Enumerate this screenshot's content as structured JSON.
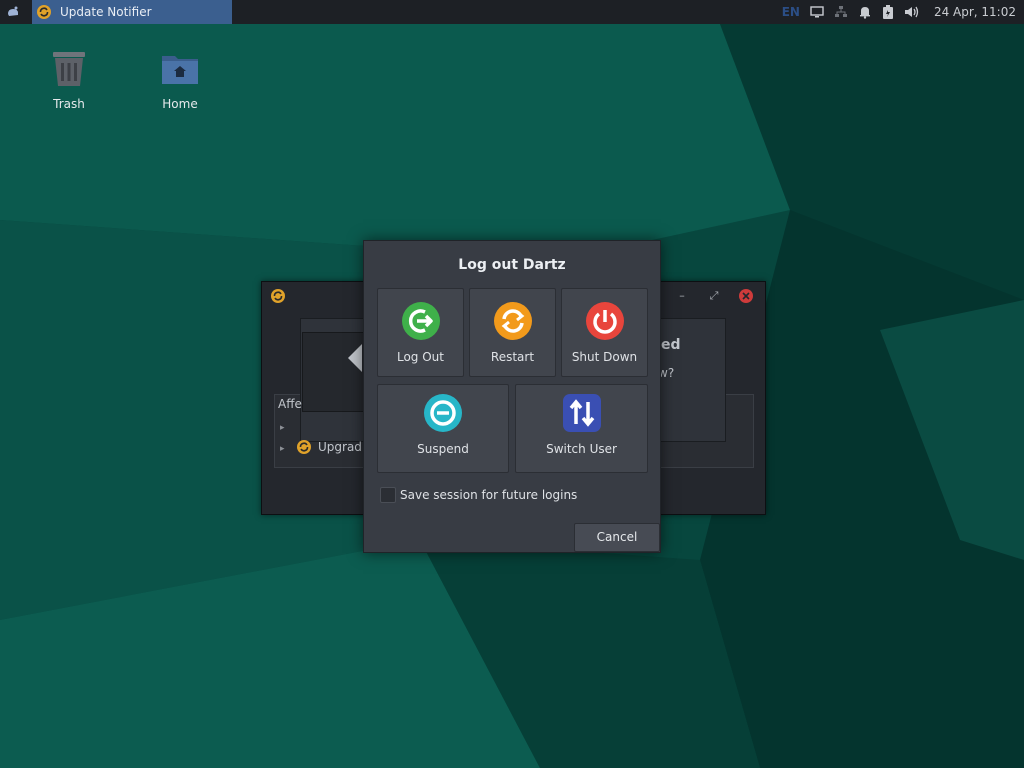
{
  "panel": {
    "task_title": "Update Notifier",
    "tray_language": "EN",
    "clock": "24 Apr, 11:02"
  },
  "desktop": {
    "icons": [
      {
        "label": "Trash",
        "icon": "trash-icon"
      },
      {
        "label": "Home",
        "icon": "home-folder-icon"
      }
    ]
  },
  "background_window": {
    "heading_fragment": "cted",
    "question_fragment": "w?",
    "list_label": "Affe",
    "list_item": "Upgrad"
  },
  "logout_dialog": {
    "title": "Log out Dartz",
    "buttons": [
      {
        "label": "Log Out",
        "icon": "log-out-icon",
        "color": "#3fb04a"
      },
      {
        "label": "Restart",
        "icon": "restart-icon",
        "color": "#f29a1b"
      },
      {
        "label": "Shut Down",
        "icon": "power-icon",
        "color": "#e8453c"
      },
      {
        "label": "Suspend",
        "icon": "suspend-icon",
        "color": "#27b6c8"
      },
      {
        "label": "Switch User",
        "icon": "switch-user-icon",
        "color": "#3a4fb3"
      }
    ],
    "save_session_label": "Save session for future logins",
    "save_session_checked": false,
    "cancel_label": "Cancel"
  }
}
